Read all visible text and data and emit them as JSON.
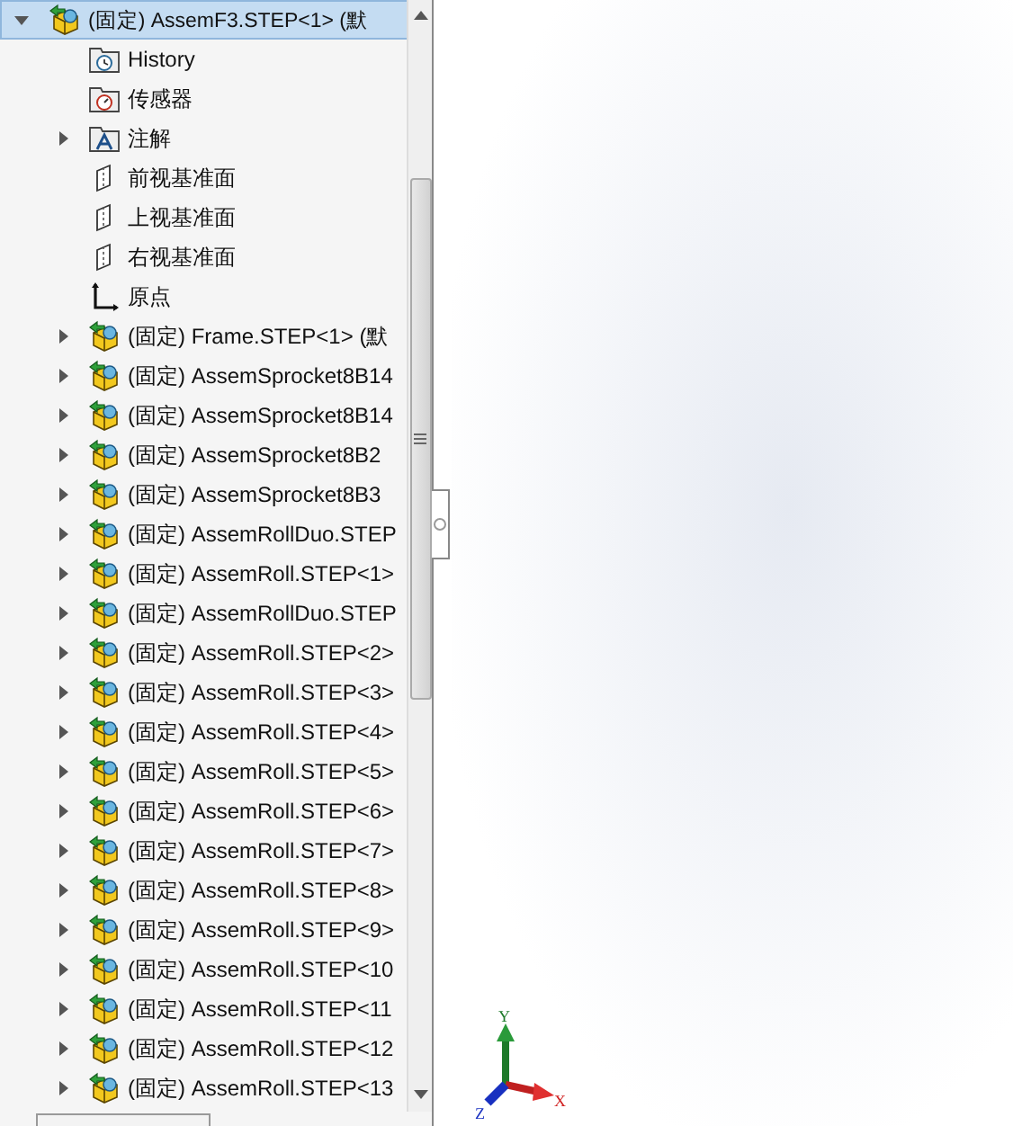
{
  "tree": {
    "root": {
      "label": "(固定) AssemF3.STEP<1> (默",
      "expanded": true,
      "selected": true
    },
    "items": [
      {
        "kind": "history",
        "label": "History"
      },
      {
        "kind": "sensor",
        "label": "传感器"
      },
      {
        "kind": "annotation",
        "label": "注解",
        "expanded": false
      },
      {
        "kind": "plane",
        "label": "前视基准面"
      },
      {
        "kind": "plane",
        "label": "上视基准面"
      },
      {
        "kind": "plane",
        "label": "右视基准面"
      },
      {
        "kind": "origin",
        "label": "原点"
      },
      {
        "kind": "part",
        "label": "(固定) Frame.STEP<1> (默",
        "expanded": false
      },
      {
        "kind": "part",
        "label": "(固定) AssemSprocket8B14",
        "expanded": false
      },
      {
        "kind": "part",
        "label": "(固定) AssemSprocket8B14",
        "expanded": false
      },
      {
        "kind": "part",
        "label": "(固定) AssemSprocket8B2",
        "expanded": false
      },
      {
        "kind": "part",
        "label": "(固定) AssemSprocket8B3",
        "expanded": false
      },
      {
        "kind": "part",
        "label": "(固定) AssemRollDuo.STEP",
        "expanded": false
      },
      {
        "kind": "part",
        "label": "(固定) AssemRoll.STEP<1>",
        "expanded": false
      },
      {
        "kind": "part",
        "label": "(固定) AssemRollDuo.STEP",
        "expanded": false
      },
      {
        "kind": "part",
        "label": "(固定) AssemRoll.STEP<2>",
        "expanded": false
      },
      {
        "kind": "part",
        "label": "(固定) AssemRoll.STEP<3>",
        "expanded": false
      },
      {
        "kind": "part",
        "label": "(固定) AssemRoll.STEP<4>",
        "expanded": false
      },
      {
        "kind": "part",
        "label": "(固定) AssemRoll.STEP<5>",
        "expanded": false
      },
      {
        "kind": "part",
        "label": "(固定) AssemRoll.STEP<6>",
        "expanded": false
      },
      {
        "kind": "part",
        "label": "(固定) AssemRoll.STEP<7>",
        "expanded": false
      },
      {
        "kind": "part",
        "label": "(固定) AssemRoll.STEP<8>",
        "expanded": false
      },
      {
        "kind": "part",
        "label": "(固定) AssemRoll.STEP<9>",
        "expanded": false
      },
      {
        "kind": "part",
        "label": "(固定) AssemRoll.STEP<10",
        "expanded": false
      },
      {
        "kind": "part",
        "label": "(固定) AssemRoll.STEP<11",
        "expanded": false
      },
      {
        "kind": "part",
        "label": "(固定) AssemRoll.STEP<12",
        "expanded": false
      },
      {
        "kind": "part",
        "label": "(固定) AssemRoll.STEP<13",
        "expanded": false
      }
    ]
  },
  "triad": {
    "x": "X",
    "y": "Y",
    "z": "Z"
  }
}
